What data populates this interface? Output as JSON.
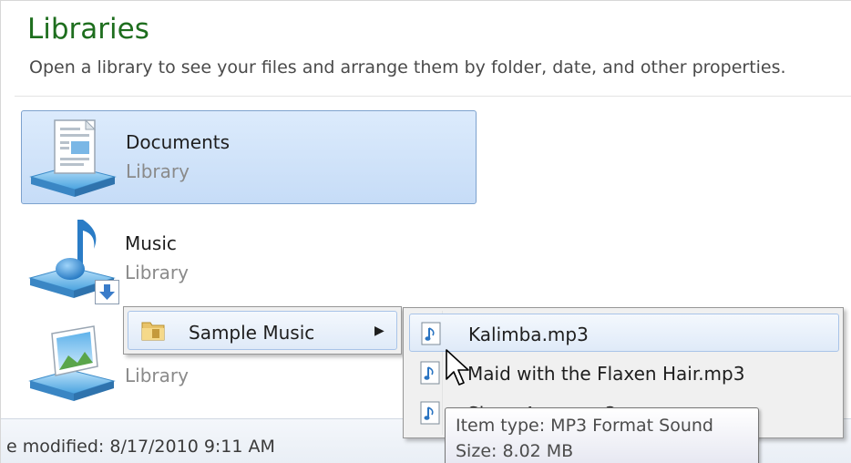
{
  "header": {
    "title": "Libraries",
    "subtitle": "Open a library to see your files and arrange them by folder, date, and other properties."
  },
  "libraries": [
    {
      "name": "Documents",
      "type": "Library",
      "icon": "documents-library-icon",
      "selected": true
    },
    {
      "name": "Music",
      "type": "Library",
      "icon": "music-library-icon",
      "selected": false
    },
    {
      "name": "",
      "type": "Library",
      "icon": "pictures-library-icon",
      "selected": false
    }
  ],
  "status_bar": {
    "text": "e modified:  8/17/2010 9:11 AM"
  },
  "context_menu": {
    "item_label": "Sample Music",
    "item_icon": "folder-icon"
  },
  "submenu": {
    "items": [
      {
        "label": "Kalimba.mp3",
        "icon": "audio-file-icon"
      },
      {
        "label": "Maid with the Flaxen Hair.mp3",
        "icon": "audio-file-icon"
      },
      {
        "label": "Sleep Away.mp3",
        "icon": "audio-file-icon"
      }
    ]
  },
  "tooltip": {
    "item_type": "Item type: MP3 Format Sound",
    "size": "Size: 8.02 MB"
  },
  "colors": {
    "title_green": "#1e6e1e",
    "selection_border": "#7da2ce",
    "selection_fill": "#c6dcf7"
  }
}
